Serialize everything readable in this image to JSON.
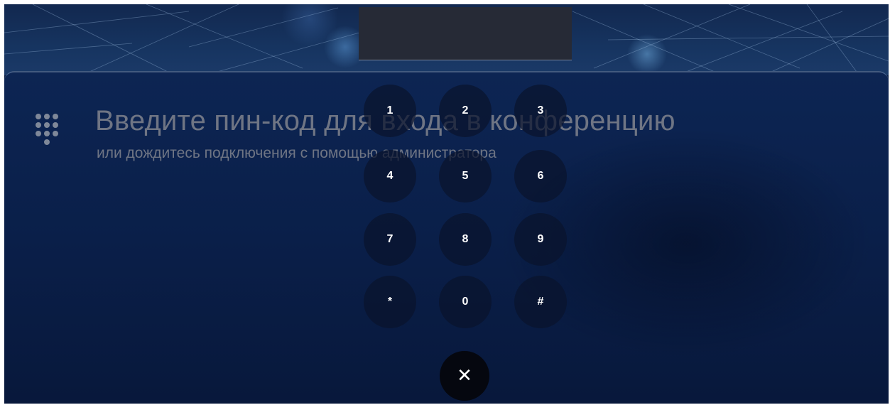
{
  "pin_display": {
    "value": ""
  },
  "title": "Введите пин-код для входа в конференцию",
  "subtitle": "или дождитесь подключения с помощью администратора",
  "keypad": {
    "keys": [
      "1",
      "2",
      "3",
      "4",
      "5",
      "6",
      "7",
      "8",
      "9",
      "*",
      "0",
      "#"
    ]
  },
  "close_button": {
    "label": "✕",
    "icon": "close-icon"
  },
  "colors": {
    "background": "#0a1f49",
    "pin_display": "#262a36",
    "key_background": "#0a142d",
    "key_text": "#ffffff",
    "title_text": "#6f7584",
    "close_button": "#05070f"
  }
}
